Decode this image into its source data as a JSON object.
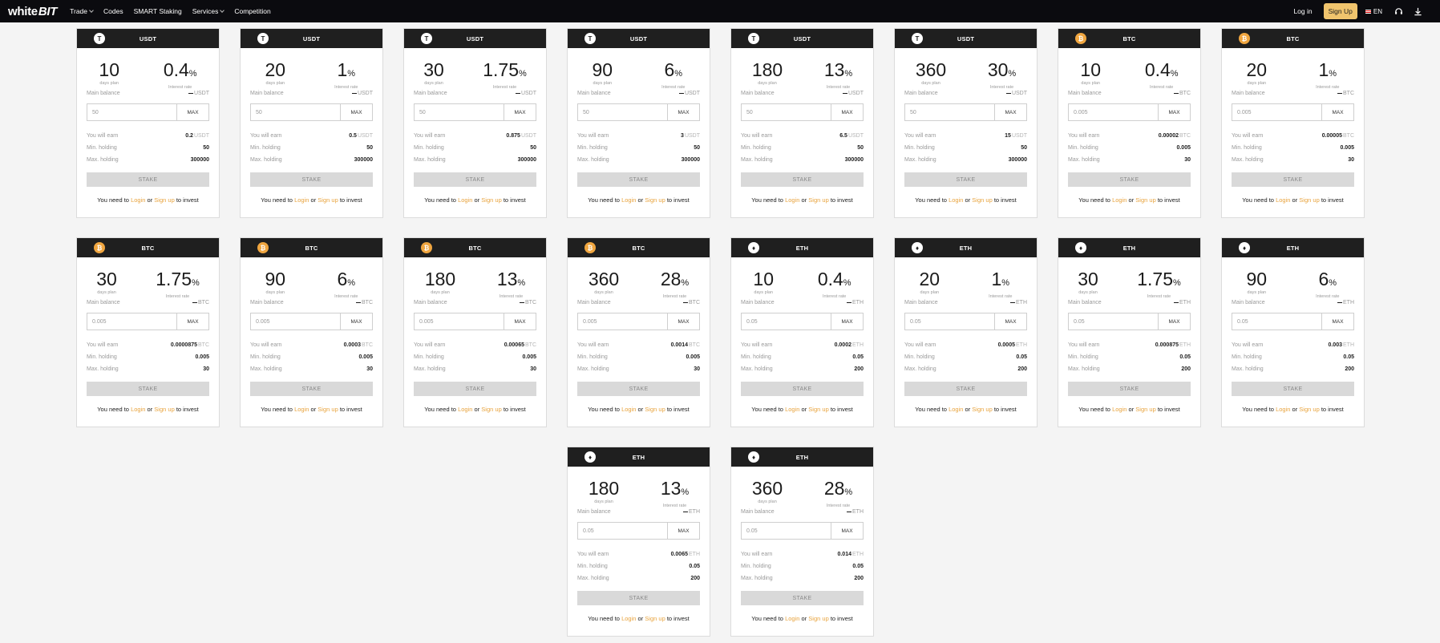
{
  "header": {
    "logo_part1": "white",
    "logo_part2": "BIT",
    "nav": [
      "Trade",
      "Codes",
      "SMART Staking",
      "Services",
      "Competition"
    ],
    "login": "Log in",
    "signup": "Sign Up",
    "lang": "EN"
  },
  "labels": {
    "days_plan": "days plan",
    "interest_rate": "Interest rate",
    "main_balance": "Main balance",
    "you_will_earn": "You will earn",
    "min_holding": "Min. holding",
    "max_holding": "Max. holding",
    "stake": "STAKE",
    "max": "MAX",
    "need_prefix": "You need to",
    "login_link": "Login",
    "or": "or",
    "signup_link": "Sign up",
    "need_suffix": "to invest"
  },
  "cards": [
    {
      "coin": "USDT",
      "days": "10",
      "rate": "0.4",
      "placeholder": "50",
      "earn": "0.2",
      "min": "50",
      "max": "300000"
    },
    {
      "coin": "USDT",
      "days": "20",
      "rate": "1",
      "placeholder": "50",
      "earn": "0.5",
      "min": "50",
      "max": "300000"
    },
    {
      "coin": "USDT",
      "days": "30",
      "rate": "1.75",
      "placeholder": "50",
      "earn": "0.875",
      "min": "50",
      "max": "300000"
    },
    {
      "coin": "USDT",
      "days": "90",
      "rate": "6",
      "placeholder": "50",
      "earn": "3",
      "min": "50",
      "max": "300000"
    },
    {
      "coin": "USDT",
      "days": "180",
      "rate": "13",
      "placeholder": "50",
      "earn": "6.5",
      "min": "50",
      "max": "300000"
    },
    {
      "coin": "USDT",
      "days": "360",
      "rate": "30",
      "placeholder": "50",
      "earn": "15",
      "min": "50",
      "max": "300000"
    },
    {
      "coin": "BTC",
      "days": "10",
      "rate": "0.4",
      "placeholder": "0.005",
      "earn": "0.00002",
      "min": "0.005",
      "max": "30"
    },
    {
      "coin": "BTC",
      "days": "20",
      "rate": "1",
      "placeholder": "0.005",
      "earn": "0.00005",
      "min": "0.005",
      "max": "30"
    },
    {
      "coin": "BTC",
      "days": "30",
      "rate": "1.75",
      "placeholder": "0.005",
      "earn": "0.0000875",
      "min": "0.005",
      "max": "30"
    },
    {
      "coin": "BTC",
      "days": "90",
      "rate": "6",
      "placeholder": "0.005",
      "earn": "0.0003",
      "min": "0.005",
      "max": "30"
    },
    {
      "coin": "BTC",
      "days": "180",
      "rate": "13",
      "placeholder": "0.005",
      "earn": "0.00065",
      "min": "0.005",
      "max": "30"
    },
    {
      "coin": "BTC",
      "days": "360",
      "rate": "28",
      "placeholder": "0.005",
      "earn": "0.0014",
      "min": "0.005",
      "max": "30"
    },
    {
      "coin": "ETH",
      "days": "10",
      "rate": "0.4",
      "placeholder": "0.05",
      "earn": "0.0002",
      "min": "0.05",
      "max": "200"
    },
    {
      "coin": "ETH",
      "days": "20",
      "rate": "1",
      "placeholder": "0.05",
      "earn": "0.0005",
      "min": "0.05",
      "max": "200"
    },
    {
      "coin": "ETH",
      "days": "30",
      "rate": "1.75",
      "placeholder": "0.05",
      "earn": "0.000875",
      "min": "0.05",
      "max": "200"
    },
    {
      "coin": "ETH",
      "days": "90",
      "rate": "6",
      "placeholder": "0.05",
      "earn": "0.003",
      "min": "0.05",
      "max": "200"
    },
    {
      "coin": "ETH",
      "days": "180",
      "rate": "13",
      "placeholder": "0.05",
      "earn": "0.0065",
      "min": "0.05",
      "max": "200"
    },
    {
      "coin": "ETH",
      "days": "360",
      "rate": "28",
      "placeholder": "0.05",
      "earn": "0.014",
      "min": "0.05",
      "max": "200"
    }
  ]
}
